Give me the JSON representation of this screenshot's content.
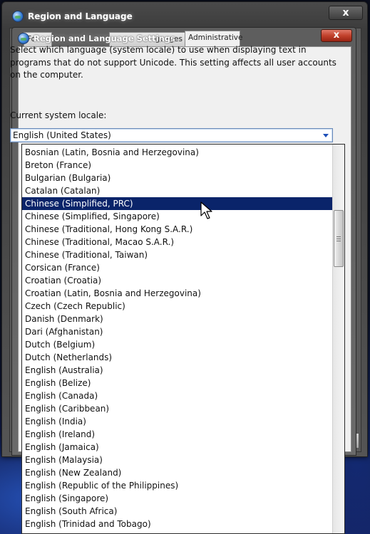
{
  "outer_window": {
    "title": "Region and Language",
    "close_symbol": "x"
  },
  "inner_dialog": {
    "title": "Region and Language Settings",
    "close_symbol": "x",
    "tabs": [
      {
        "label": "Fo"
      },
      {
        "label": "guages"
      },
      {
        "label": "Administrative"
      }
    ]
  },
  "description": "Select which language (system locale) to use when displaying text in programs that do not support Unicode. This setting affects all user accounts on the computer.",
  "locale_label": "Current system locale:",
  "locale_select": {
    "value": "English (United States)"
  },
  "locale_options": [
    "Bosnian (Latin, Bosnia and Herzegovina)",
    "Breton (France)",
    "Bulgarian (Bulgaria)",
    "Catalan (Catalan)",
    "Chinese (Simplified, PRC)",
    "Chinese (Simplified, Singapore)",
    "Chinese (Traditional, Hong Kong S.A.R.)",
    "Chinese (Traditional, Macao S.A.R.)",
    "Chinese (Traditional, Taiwan)",
    "Corsican (France)",
    "Croatian (Croatia)",
    "Croatian (Latin, Bosnia and Herzegovina)",
    "Czech (Czech Republic)",
    "Danish (Denmark)",
    "Dari (Afghanistan)",
    "Dutch (Belgium)",
    "Dutch (Netherlands)",
    "English (Australia)",
    "English (Belize)",
    "English (Canada)",
    "English (Caribbean)",
    "English (India)",
    "English (Ireland)",
    "English (Jamaica)",
    "English (Malaysia)",
    "English (New Zealand)",
    "English (Republic of the Philippines)",
    "English (Singapore)",
    "English (South Africa)",
    "English (Trinidad and Tobago)"
  ],
  "highlighted_option_index": 4,
  "colors": {
    "selection": "#0a246a",
    "close_button": "#c2412c"
  }
}
